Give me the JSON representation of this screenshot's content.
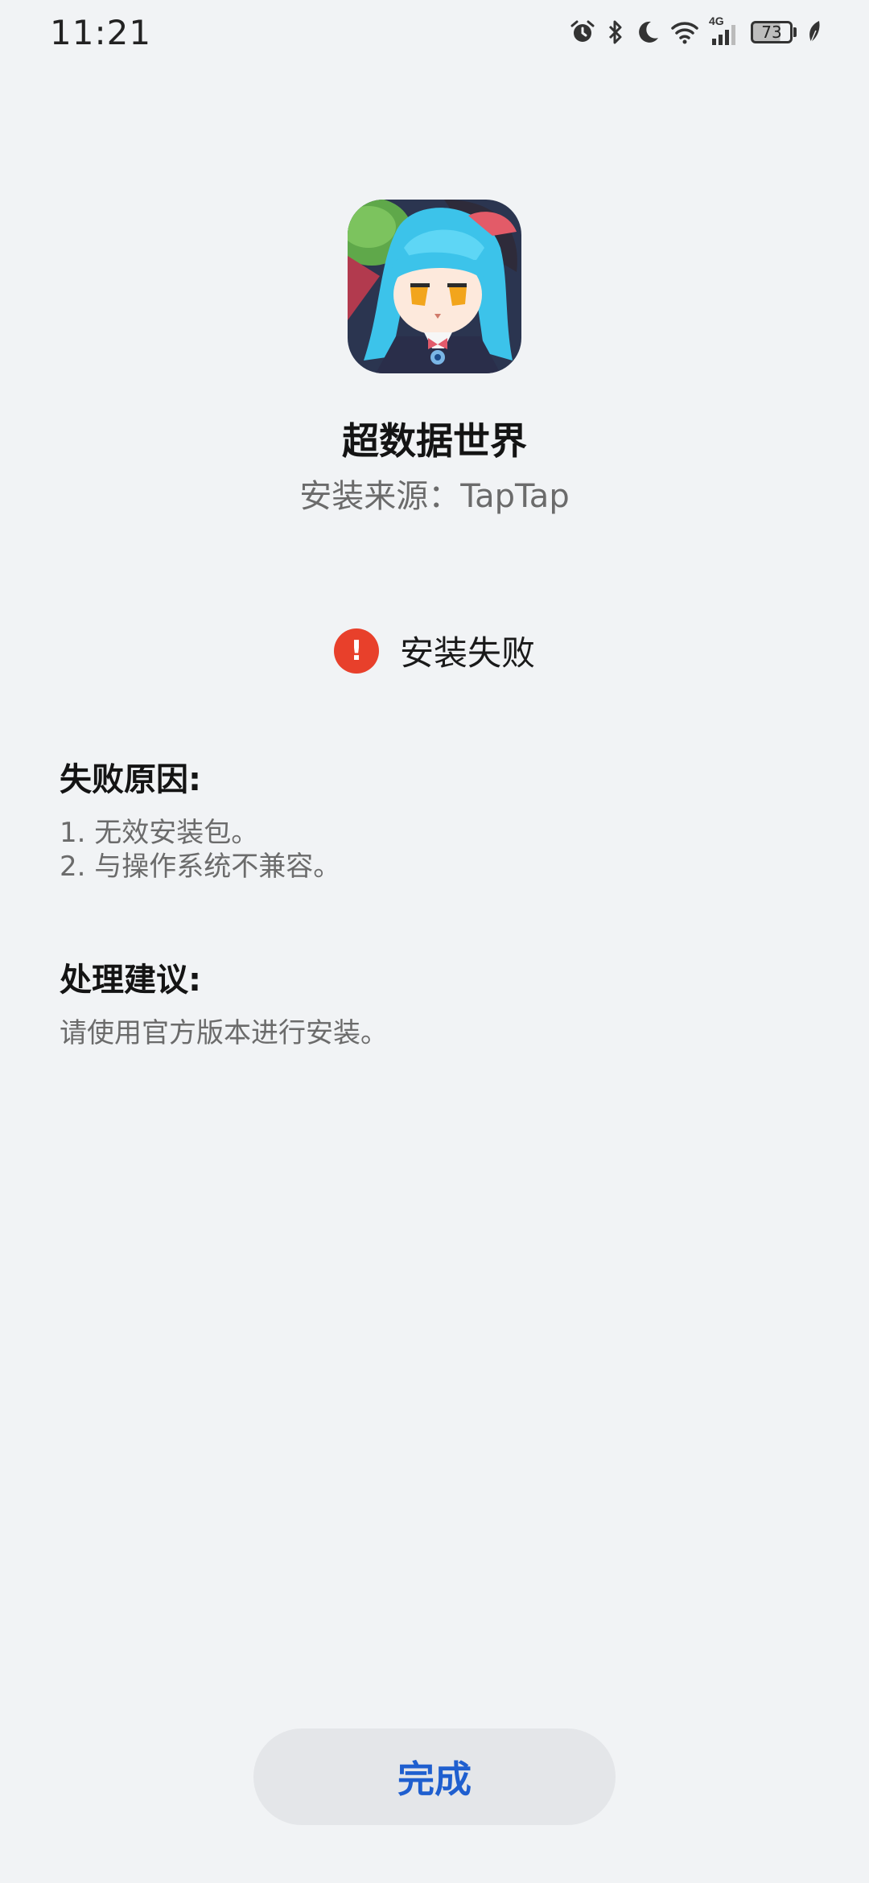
{
  "status_bar": {
    "time": "11:21",
    "network_label": "4G",
    "battery_level": "73",
    "icons": [
      "alarm-icon",
      "bluetooth-icon",
      "moon-icon",
      "wifi-icon",
      "signal-icon",
      "battery-icon",
      "leaf-icon"
    ]
  },
  "app": {
    "name": "超数据世界",
    "source": "安装来源：TapTap"
  },
  "result": {
    "icon": "error-icon",
    "text": "安装失败",
    "color": "#e8402b"
  },
  "reasons": {
    "title": "失败原因:",
    "items": [
      "1. 无效安装包。",
      "2. 与操作系统不兼容。"
    ]
  },
  "suggestions": {
    "title": "处理建议:",
    "items": [
      "请使用官方版本进行安装。"
    ]
  },
  "actions": {
    "done_label": "完成",
    "accent": "#1f5fcf"
  }
}
